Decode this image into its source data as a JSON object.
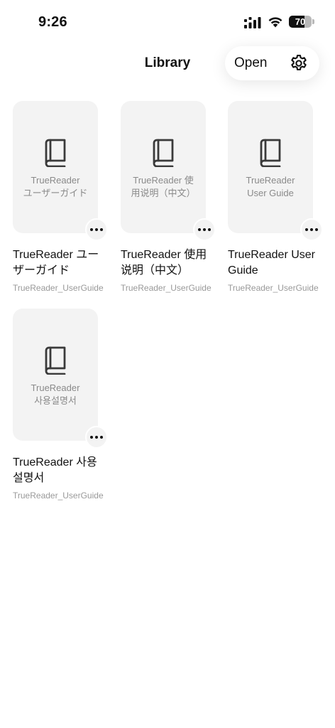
{
  "status_bar": {
    "time": "9:26",
    "battery_level": "70",
    "battery_fraction": 0.7
  },
  "header": {
    "title": "Library",
    "open_label": "Open",
    "settings_icon": "gear-icon"
  },
  "colors": {
    "cover_bg": "#f3f3f3",
    "cover_text": "#8a8a8a",
    "file_text": "#999999",
    "icon": "#3a3a3a"
  },
  "books": [
    {
      "cover_text": "TrueReader\nユーザーガイド",
      "title": "TrueReader ユーザーガイド",
      "file": "TrueReader_UserGuide",
      "icon": "book-icon"
    },
    {
      "cover_text": "TrueReader 使\n用说明（中文）",
      "title": "TrueReader 使用说明（中文）",
      "file": "TrueReader_UserGuide",
      "icon": "book-icon"
    },
    {
      "cover_text": "TrueReader\nUser Guide",
      "title": "TrueReader User Guide",
      "file": "TrueReader_UserGuide",
      "icon": "book-icon"
    },
    {
      "cover_text": "TrueReader\n사용설명서",
      "title": "TrueReader 사용설명서",
      "file": "TrueReader_UserGuide",
      "icon": "book-icon"
    }
  ]
}
